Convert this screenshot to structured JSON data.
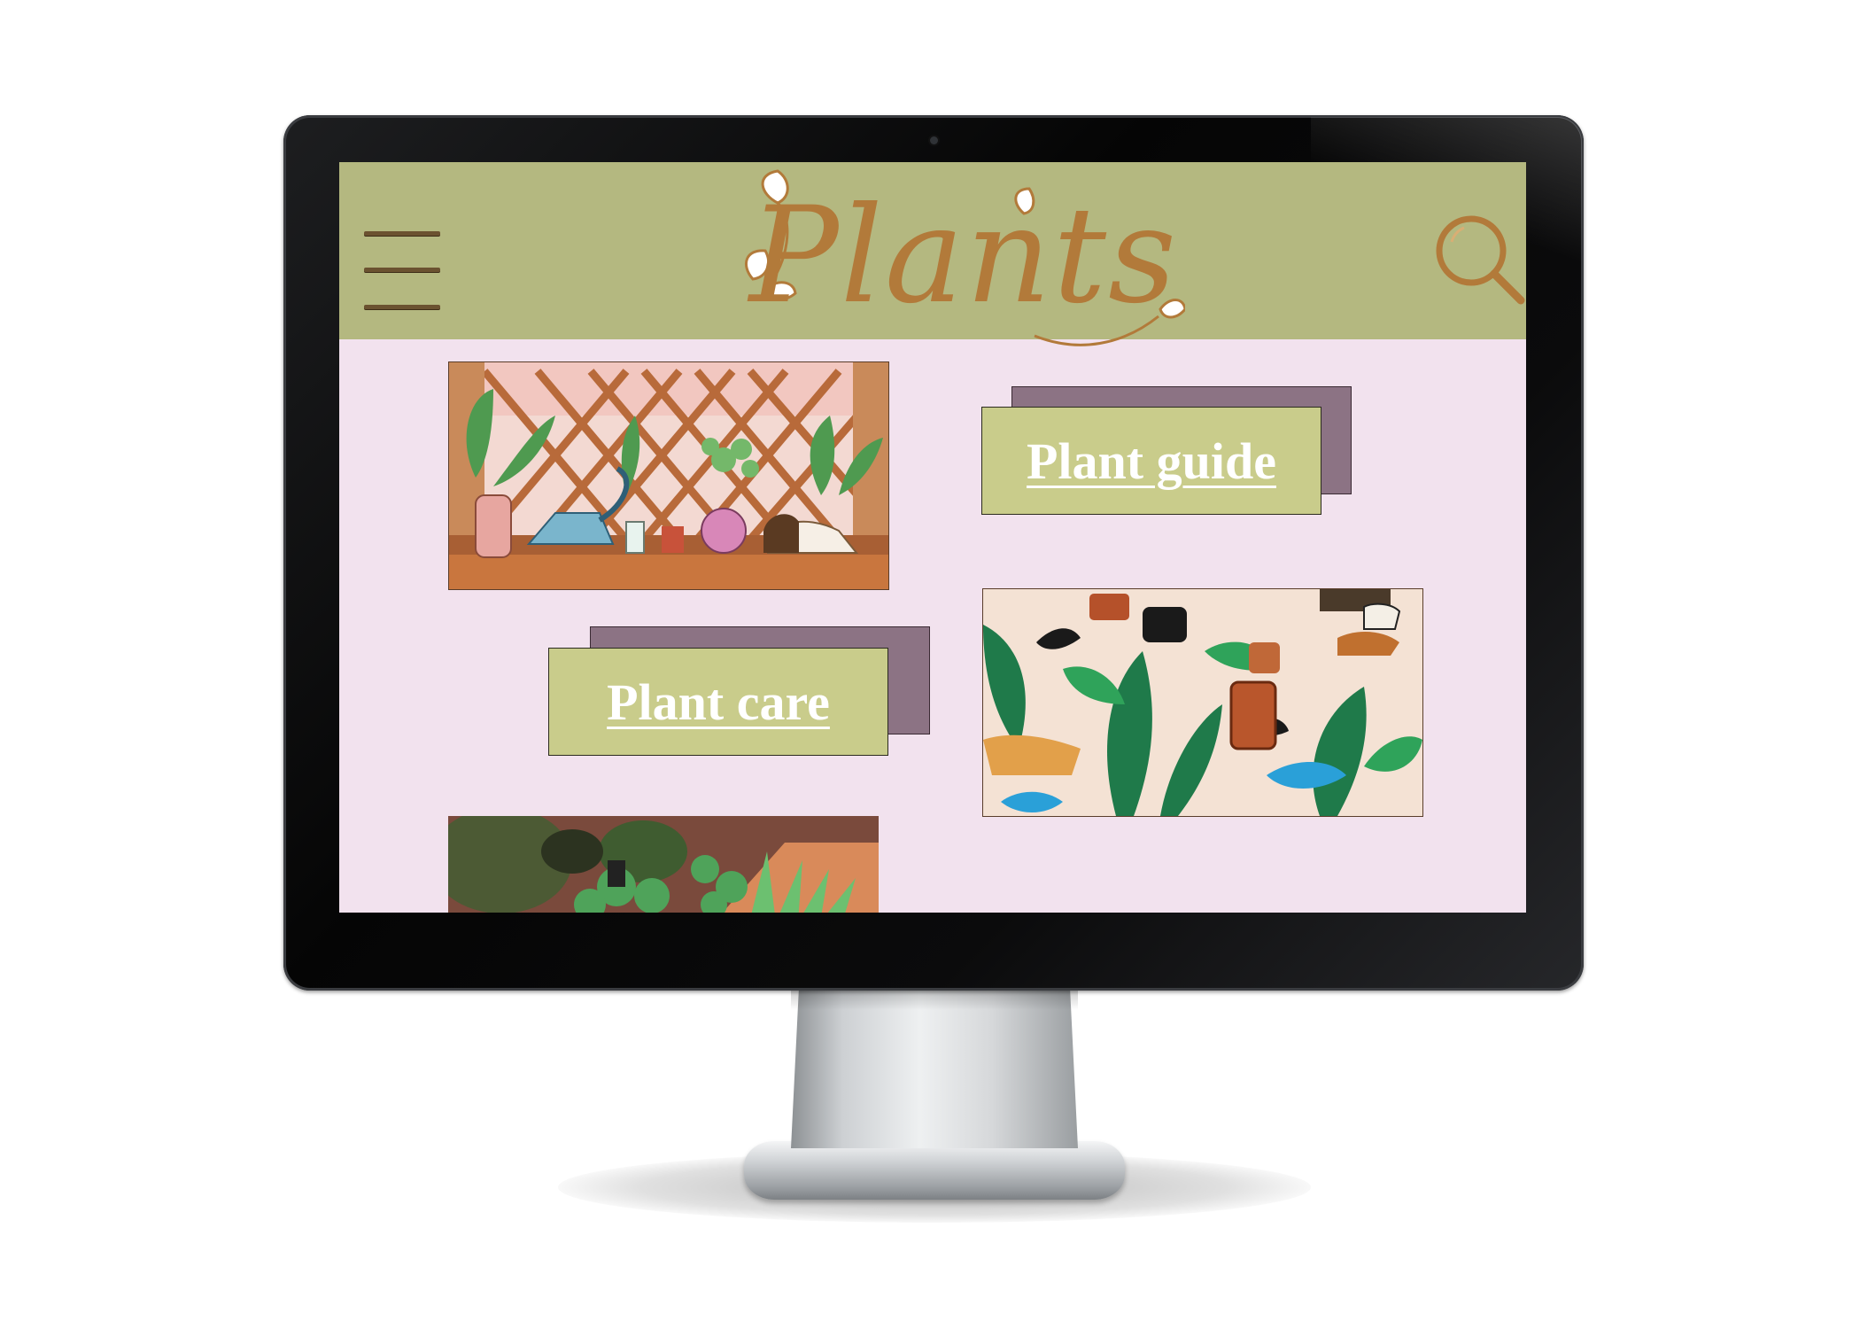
{
  "app": {
    "logo_text": "Plants"
  },
  "header": {
    "menu_icon": "hamburger-menu-icon",
    "search_icon": "search-icon",
    "background_color": "#b4b880",
    "accent_color": "#b27a3a"
  },
  "main": {
    "background_color": "#f2e2ee",
    "links": [
      {
        "label": "Plant guide"
      },
      {
        "label": "Plant care"
      }
    ]
  }
}
